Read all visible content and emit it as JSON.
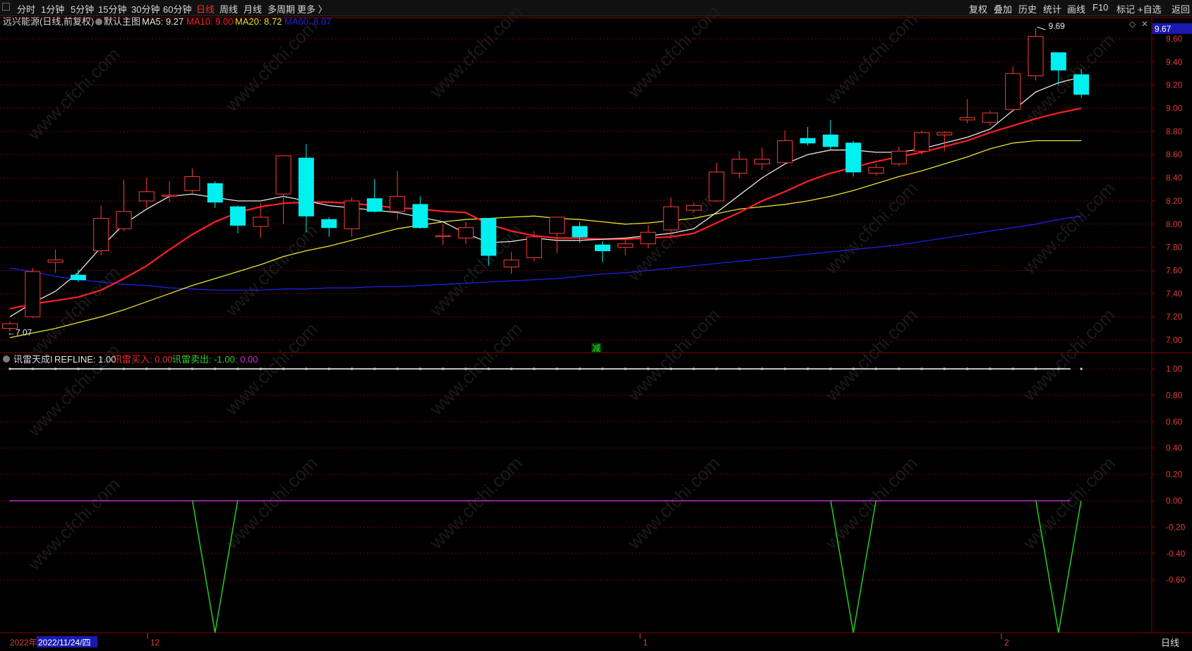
{
  "toolbar": {
    "periods": [
      "分时",
      "1分钟",
      "5分钟",
      "15分钟",
      "30分钟",
      "60分钟",
      "日线",
      "周线",
      "月线",
      "多周期",
      "更多 〉"
    ],
    "active_period": "日线",
    "right_buttons": [
      "复权",
      "叠加",
      "历史",
      "统计",
      "画线",
      "F10",
      "标记",
      "+自选",
      "返回"
    ]
  },
  "main_header": {
    "stock": "远兴能源(日线,前复权)",
    "chart_name": "默认主图",
    "ma5": "MA5: 9.27",
    "ma10": "MA10: 9.00",
    "ma20": "MA20: 8.72",
    "ma60": "MA60: 8.07"
  },
  "indicator_header": {
    "name": "讯雷天成I",
    "refline": "REFLINE: 1.00",
    "buy": "讯雷买入: 0.00",
    "sell": "讯雷卖出: -1.00",
    "extra": ": 0.00"
  },
  "annotations": {
    "high_label": "9.69",
    "low_label": "←7.07",
    "current_price": "9.67",
    "marker_text": "减",
    "diamond_icon": "◇",
    "close_icon": "✕"
  },
  "date_axis": {
    "year_label": "2022年",
    "cursor_date": "2022/11/24/四",
    "month_labels": [
      "12",
      "1",
      "2"
    ]
  },
  "bottom_right_label": "日线",
  "watermark": "www.cfchi.com",
  "colors": {
    "bg": "#000000",
    "up": "#ff3b3b",
    "down": "#00f0f0",
    "ma5": "#e8e8e8",
    "ma10": "#ff2020",
    "ma20": "#e6e62a",
    "ma60": "#2020e0",
    "grid": "#7a0000",
    "axis_text": "#e03c3c",
    "refline": "#ffffff",
    "buy_line": "#c030c0",
    "sell_line": "#20d020"
  },
  "chart_data": {
    "type": "candlestick",
    "price_axis": {
      "min": 7.0,
      "max": 9.6,
      "ticks": [
        "9.60",
        "9.40",
        "9.20",
        "9.00",
        "8.80",
        "8.60",
        "8.40",
        "8.20",
        "8.00",
        "7.80",
        "7.60",
        "7.40",
        "7.20",
        "7.00"
      ]
    },
    "indicator_axis": {
      "min": -1.0,
      "max": 1.0,
      "ticks": [
        "1.00",
        "0.80",
        "0.60",
        "0.40",
        "0.20",
        "0.00",
        "-0.20",
        "-0.40",
        "-0.60"
      ]
    },
    "candles": [
      [
        7.1,
        7.14,
        7.16,
        7.07
      ],
      [
        7.2,
        7.59,
        7.62,
        7.19
      ],
      [
        7.67,
        7.69,
        7.78,
        7.58
      ],
      [
        7.56,
        7.52,
        7.61,
        7.5
      ],
      [
        7.77,
        8.05,
        8.16,
        7.73
      ],
      [
        7.96,
        8.11,
        8.38,
        7.94
      ],
      [
        8.2,
        8.28,
        8.4,
        8.14
      ],
      [
        8.25,
        8.25,
        8.37,
        8.19
      ],
      [
        8.29,
        8.41,
        8.48,
        8.27
      ],
      [
        8.35,
        8.19,
        8.37,
        8.14
      ],
      [
        8.15,
        7.99,
        8.16,
        7.92
      ],
      [
        7.98,
        8.06,
        8.18,
        7.88
      ],
      [
        8.26,
        8.59,
        8.59,
        8.0
      ],
      [
        8.57,
        8.07,
        8.69,
        7.93
      ],
      [
        8.04,
        7.97,
        8.06,
        7.89
      ],
      [
        7.96,
        8.2,
        8.23,
        7.89
      ],
      [
        8.22,
        8.11,
        8.39,
        8.1
      ],
      [
        8.11,
        8.24,
        8.46,
        8.04
      ],
      [
        8.17,
        7.97,
        8.24,
        7.96
      ],
      [
        7.9,
        7.9,
        8.0,
        7.82
      ],
      [
        7.88,
        7.97,
        8.02,
        7.83
      ],
      [
        8.05,
        7.73,
        8.05,
        7.64
      ],
      [
        7.63,
        7.69,
        7.76,
        7.57
      ],
      [
        7.71,
        7.89,
        7.94,
        7.68
      ],
      [
        7.92,
        8.06,
        8.06,
        7.75
      ],
      [
        7.98,
        7.89,
        8.02,
        7.84
      ],
      [
        7.82,
        7.77,
        7.85,
        7.67
      ],
      [
        7.8,
        7.83,
        7.87,
        7.73
      ],
      [
        7.83,
        7.93,
        7.99,
        7.79
      ],
      [
        7.95,
        8.15,
        8.23,
        7.88
      ],
      [
        8.12,
        8.16,
        8.19,
        8.1
      ],
      [
        8.2,
        8.45,
        8.53,
        8.19
      ],
      [
        8.44,
        8.56,
        8.63,
        8.4
      ],
      [
        8.52,
        8.56,
        8.66,
        8.47
      ],
      [
        8.53,
        8.72,
        8.81,
        8.52
      ],
      [
        8.74,
        8.7,
        8.84,
        8.68
      ],
      [
        8.77,
        8.67,
        8.9,
        8.64
      ],
      [
        8.7,
        8.45,
        8.72,
        8.41
      ],
      [
        8.44,
        8.49,
        8.52,
        8.42
      ],
      [
        8.52,
        8.63,
        8.67,
        8.5
      ],
      [
        8.63,
        8.79,
        8.81,
        8.6
      ],
      [
        8.77,
        8.79,
        8.8,
        8.63
      ],
      [
        8.9,
        8.92,
        9.08,
        8.87
      ],
      [
        8.88,
        8.96,
        8.98,
        8.85
      ],
      [
        8.99,
        9.3,
        9.36,
        8.97
      ],
      [
        9.28,
        9.62,
        9.69,
        9.24
      ],
      [
        9.48,
        9.33,
        9.48,
        9.2
      ],
      [
        9.29,
        9.12,
        9.34,
        9.09
      ]
    ],
    "ma5": [
      7.2,
      7.32,
      7.42,
      7.58,
      7.8,
      8.0,
      8.13,
      8.24,
      8.26,
      8.23,
      8.2,
      8.2,
      8.24,
      8.2,
      8.16,
      8.14,
      8.12,
      8.1,
      8.06,
      8.02,
      7.92,
      7.84,
      7.85,
      7.88,
      7.86,
      7.86,
      7.87,
      7.88,
      7.9,
      7.92,
      7.96,
      8.1,
      8.25,
      8.4,
      8.52,
      8.6,
      8.64,
      8.64,
      8.62,
      8.62,
      8.65,
      8.7,
      8.75,
      8.82,
      8.98,
      9.14,
      9.22,
      9.27
    ],
    "ma10": [
      7.27,
      7.31,
      7.34,
      7.37,
      7.43,
      7.53,
      7.64,
      7.78,
      7.91,
      8.02,
      8.1,
      8.15,
      8.18,
      8.19,
      8.19,
      8.18,
      8.16,
      8.14,
      8.13,
      8.11,
      8.1,
      8.0,
      7.94,
      7.9,
      7.88,
      7.88,
      7.87,
      7.87,
      7.88,
      7.89,
      7.92,
      8.01,
      8.1,
      8.2,
      8.28,
      8.37,
      8.44,
      8.49,
      8.54,
      8.58,
      8.62,
      8.67,
      8.72,
      8.79,
      8.85,
      8.91,
      8.96,
      9.0
    ],
    "ma20": [
      7.02,
      7.06,
      7.1,
      7.15,
      7.2,
      7.26,
      7.33,
      7.4,
      7.47,
      7.53,
      7.59,
      7.65,
      7.72,
      7.77,
      7.81,
      7.86,
      7.91,
      7.96,
      7.99,
      8.02,
      8.04,
      8.05,
      8.06,
      8.07,
      8.05,
      8.04,
      8.02,
      8.0,
      8.01,
      8.03,
      8.05,
      8.09,
      8.13,
      8.15,
      8.17,
      8.2,
      8.24,
      8.29,
      8.35,
      8.41,
      8.46,
      8.52,
      8.58,
      8.65,
      8.7,
      8.72,
      8.72,
      8.72
    ],
    "ma60": [
      7.62,
      7.59,
      7.55,
      7.52,
      7.5,
      7.48,
      7.47,
      7.45,
      7.44,
      7.43,
      7.43,
      7.43,
      7.44,
      7.44,
      7.45,
      7.45,
      7.46,
      7.46,
      7.47,
      7.48,
      7.49,
      7.5,
      7.51,
      7.52,
      7.53,
      7.55,
      7.57,
      7.58,
      7.6,
      7.62,
      7.64,
      7.66,
      7.68,
      7.7,
      7.72,
      7.74,
      7.76,
      7.78,
      7.8,
      7.82,
      7.85,
      7.88,
      7.91,
      7.94,
      7.97,
      8.0,
      8.04,
      8.07
    ],
    "refline": 1.0,
    "buy_line": 0.0,
    "sell_signals": [
      9,
      37,
      46
    ],
    "sell_signal_value": -1.0
  }
}
